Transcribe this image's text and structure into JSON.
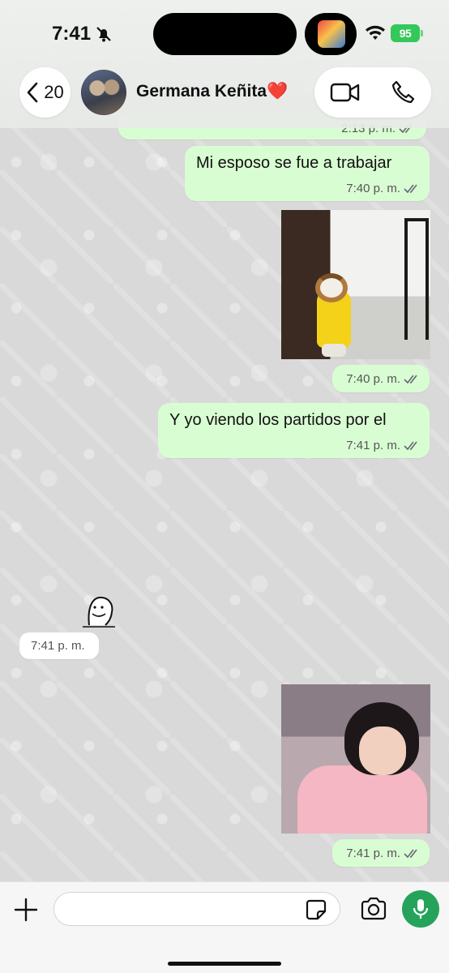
{
  "status_bar": {
    "time": "7:41",
    "battery": "95"
  },
  "header": {
    "back_count": "20",
    "contact_name": "Germana Keñita",
    "contact_emoji": "❤️"
  },
  "messages": [
    {
      "type": "partial",
      "direction": "out",
      "time": "2:13 p. m."
    },
    {
      "type": "text",
      "direction": "out",
      "text": "Mi esposo se fue a trabajar",
      "time": "7:40 p. m."
    },
    {
      "type": "media",
      "direction": "out",
      "media": "dog-gif",
      "time": "7:40 p. m."
    },
    {
      "type": "text",
      "direction": "out",
      "text": "Y yo viendo los partidos por el",
      "time": "7:41 p. m."
    },
    {
      "type": "sticker",
      "direction": "in",
      "time": "7:41 p. m."
    },
    {
      "type": "media",
      "direction": "out",
      "media": "girl-gif",
      "time": "7:41 p. m."
    }
  ],
  "input": {
    "placeholder": ""
  },
  "colors": {
    "outgoing_bubble": "#d9fdd3",
    "incoming_bubble": "#ffffff",
    "accent": "#25a35a",
    "battery": "#34c759"
  },
  "icons": [
    "bell-slash-icon",
    "wifi-icon",
    "chevron-left-icon",
    "video-icon",
    "phone-icon",
    "plus-icon",
    "sticker-icon",
    "camera-icon",
    "mic-icon",
    "double-check-icon"
  ]
}
